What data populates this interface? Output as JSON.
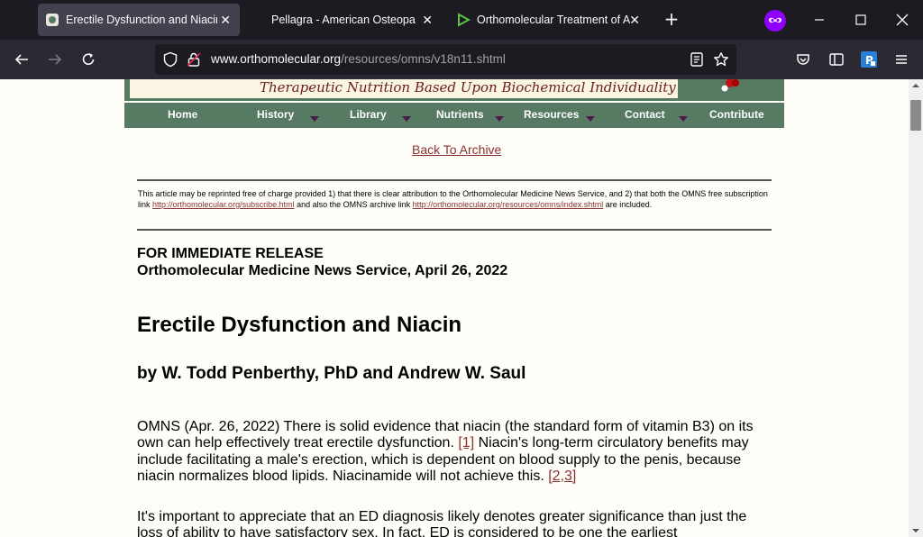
{
  "browser": {
    "tabs": [
      {
        "title": "Erectile Dysfunction and Niacin",
        "close": "✕"
      },
      {
        "title": "Pellagra - American Osteopathic",
        "close": "✕"
      },
      {
        "title": "Orthomolecular Treatment of All",
        "close": "✕"
      }
    ],
    "new_tab": "+",
    "url_domain": "www.orthomolecular.org",
    "url_path": "/resources/omns/v18n11.shtml",
    "colors": {
      "accent": "#8f00ff",
      "profile": "#2a7fd8"
    }
  },
  "site": {
    "tagline": "Therapeutic Nutrition Based Upon Biochemical Individuality",
    "menu": [
      "Home",
      "History",
      "Library",
      "Nutrients",
      "Resources",
      "Contact",
      "Contribute"
    ],
    "back_link": "Back To Archive"
  },
  "notice": {
    "text1": "This article may be reprinted free of charge provided 1) that there is clear attribution to the Orthomolecular Medicine News Service, and 2) that both the OMNS free subscription link ",
    "link1": "http://orthomolecular.org/subscribe.html",
    "text2": " and also the OMNS archive link ",
    "link2": "http://orthomolecular.org/resources/omns/index.shtml",
    "text3": " are included."
  },
  "article": {
    "release": "FOR IMMEDIATE RELEASE",
    "service": "Orthomolecular Medicine News Service, April 26, 2022",
    "title": "Erectile Dysfunction and Niacin",
    "byline": "by W. Todd Penberthy, PhD and Andrew W. Saul",
    "p1a": "OMNS (Apr. 26, 2022) There is solid evidence that niacin (the standard form of vitamin B3) on its own can help effectively treat erectile dysfunction. ",
    "p1ref1": "[1]",
    "p1b": " Niacin's long-term circulatory benefits may include facilitating a male's erection, which is dependent on blood supply to the penis, because niacin normalizes blood lipids. Niacinamide will not achieve this. ",
    "p1ref2": "[2,3]",
    "p2": "It's important to appreciate that an ED diagnosis likely denotes greater significance than just the loss of ability to have satisfactory sex. In fact, ED is considered to be one the earliest"
  }
}
